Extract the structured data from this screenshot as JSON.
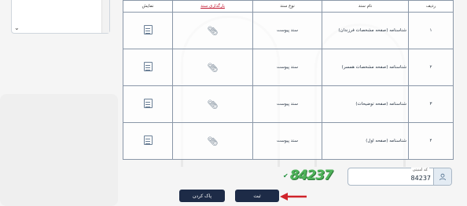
{
  "table": {
    "headers": [
      "ردیف",
      "نام سند",
      "نوع سند",
      "بارگذاری سند",
      "نمایش"
    ],
    "rows": [
      {
        "index": "۱",
        "name": "شناسنامه (صفحه مشخصات فرزندان)",
        "type": "سند پیوست"
      },
      {
        "index": "۲",
        "name": "شناسنامه (صفحه مشخصات همسر)",
        "type": "سند پیوست"
      },
      {
        "index": "۳",
        "name": "شناسنامه (صفحه توضیحات)",
        "type": "سند پیوست"
      },
      {
        "index": "۴",
        "name": "شناسنامه (صفحه اول)",
        "type": "سند پیوست"
      }
    ]
  },
  "captcha": {
    "label": "کد امنیتی",
    "value": "84237",
    "image_text": "84237"
  },
  "buttons": {
    "submit": "ثبت",
    "reset": "پاک کردن"
  },
  "icons": {
    "attach": "paperclip-icon",
    "view": "document-view-icon",
    "user": "user-icon",
    "verified": "check-shield-icon"
  },
  "colors": {
    "button_bg": "#1d2b47",
    "accent_red": "#c0152f",
    "captcha_green": "#4fb35a"
  }
}
